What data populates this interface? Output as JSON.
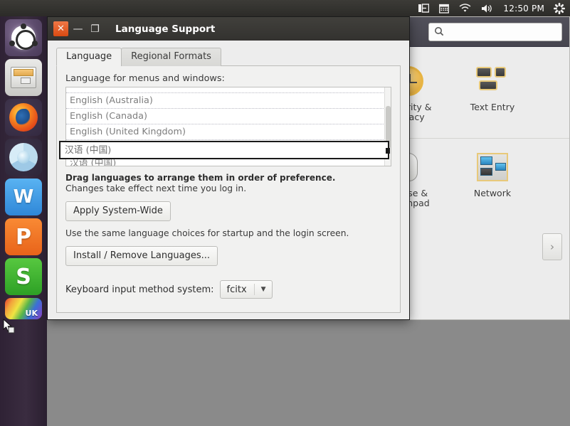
{
  "top_panel": {
    "tray": [
      {
        "name": "input-source-icon",
        "glyph": "▮⊦"
      },
      {
        "name": "calendar-icon",
        "glyph": "▦"
      },
      {
        "name": "wifi-icon",
        "glyph": "◇"
      },
      {
        "name": "volume-icon",
        "glyph": "◀))"
      }
    ],
    "clock": "12:50 PM",
    "session_menu_icon": "gear-icon"
  },
  "launcher": {
    "items": [
      {
        "name": "ubuntu-dash",
        "label": "Ubuntu Dash"
      },
      {
        "name": "files",
        "label": "Files"
      },
      {
        "name": "firefox",
        "label": "Firefox"
      },
      {
        "name": "chromium",
        "label": "Chromium"
      },
      {
        "name": "wps-writer",
        "label": "W"
      },
      {
        "name": "wps-presentation",
        "label": "P"
      },
      {
        "name": "wps-spreadsheet",
        "label": "S"
      },
      {
        "name": "flag-uk",
        "label": "UK"
      }
    ]
  },
  "settings_window": {
    "search": {
      "placeholder": "",
      "value": "",
      "icon": "search-icon"
    },
    "categories": [
      {
        "name": "security-privacy",
        "label": "Security &\nPrivacy",
        "icon": "clock-restore-icon"
      },
      {
        "name": "text-entry",
        "label": "Text Entry",
        "icon": "keyboard-keys-icon"
      },
      {
        "name": "mouse-touchpad",
        "label": "Mouse &\nTouchpad",
        "icon": "mouse-icon"
      },
      {
        "name": "network",
        "label": "Network",
        "icon": "network-monitors-icon"
      }
    ],
    "security_privacy_label_1": "Security &",
    "security_privacy_label_2": "Privacy",
    "text_entry_label": "Text Entry",
    "mouse_label_1": "Mouse &",
    "mouse_label_2": "Touchpad",
    "network_label": "Network",
    "next_arrow": "›"
  },
  "dialog": {
    "title": "Language Support",
    "titlebar": {
      "close": "✕",
      "minimize": "—",
      "maximize": "❐"
    },
    "tabs": [
      {
        "name": "tab-language",
        "label": "Language",
        "active": true
      },
      {
        "name": "tab-regional-formats",
        "label": "Regional Formats",
        "active": false
      }
    ],
    "list_label": "Language for menus and windows:",
    "language_rows": [
      {
        "label": "English (Australia)"
      },
      {
        "label": "English (Canada)"
      },
      {
        "label": "English (United Kingdom)"
      },
      {
        "label": "汉语 (中国)"
      }
    ],
    "drag_ghost_label": "汉语 (中国)",
    "hint_bold": "Drag languages to arrange them in order of preference.",
    "hint": "Changes take effect next time you log in.",
    "apply_button": "Apply System-Wide",
    "apply_note": "Use the same language choices for startup and the login screen.",
    "install_button": "Install / Remove Languages...",
    "ime_label": "Keyboard input method system:",
    "ime_value": "fcitx",
    "ime_arrow": "▼"
  },
  "colors": {
    "panel_bg": "#2f2e2b",
    "launcher_bg": "#3a2c40",
    "accent_orange": "#e4501a",
    "dialog_bg": "#ededed",
    "settings_header": "#4a4952",
    "desktop_gray": "#8a8a8a"
  }
}
